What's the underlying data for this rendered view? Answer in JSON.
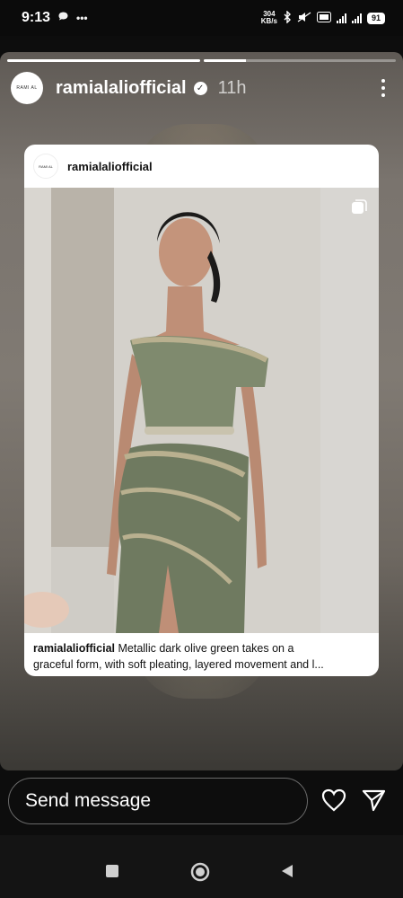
{
  "status_bar": {
    "time": "9:13",
    "net_speed_value": "304",
    "net_speed_unit": "KB/s",
    "battery": "91"
  },
  "story": {
    "progress_segments": [
      1.0,
      0.22
    ],
    "avatar_text": "RAMI AL",
    "username": "ramialaliofficial",
    "time_ago": "11h",
    "card": {
      "avatar_text": "RAMI AL",
      "username": "ramialaliofficial",
      "caption_user": "ramialaliofficial",
      "caption_line1": " Metallic dark olive green takes on a",
      "caption_line2": "graceful form, with soft pleating, layered movement and l..."
    }
  },
  "reply": {
    "placeholder": "Send message"
  },
  "icons": [
    "chat-bubble-icon",
    "more-dots-icon",
    "bluetooth-icon",
    "verified-icon",
    "multi-photo-icon",
    "heart-icon",
    "send-icon",
    "recents-icon",
    "home-icon",
    "back-icon"
  ],
  "colors": {
    "background": "#0d0d0d",
    "card": "#ffffff",
    "dress": "#7d8a6c"
  }
}
